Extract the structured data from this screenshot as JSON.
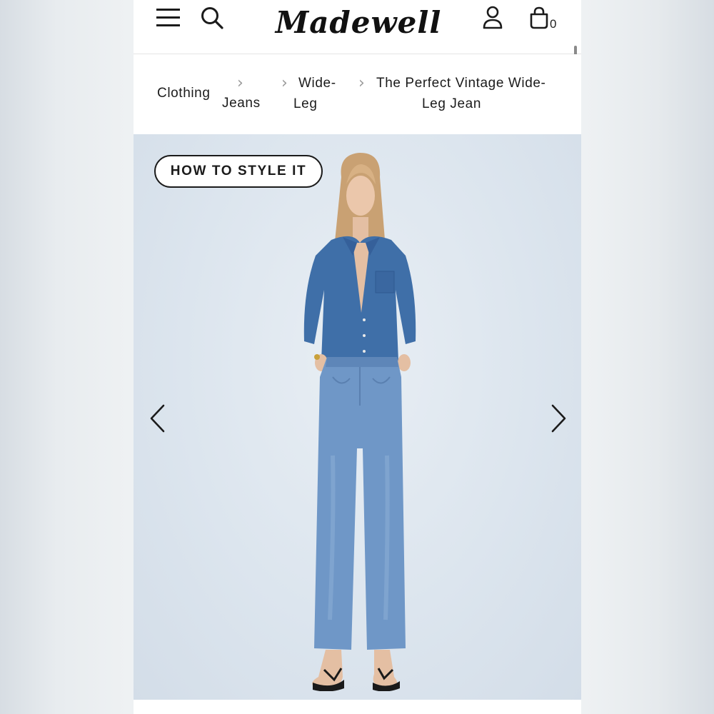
{
  "header": {
    "brand": "Madewell",
    "bag_count": "0",
    "icons": {
      "menu": "hamburger-menu-icon",
      "search": "search-icon",
      "account": "person-icon",
      "bag": "shopping-bag-icon"
    }
  },
  "breadcrumb": {
    "items": [
      {
        "label": "Clothing"
      },
      {
        "label": "Jeans"
      },
      {
        "label_line1": "Wide-",
        "label_line2": "Leg"
      },
      {
        "label_line1": "The Perfect Vintage Wide-",
        "label_line2": "Leg Jean"
      }
    ]
  },
  "hero": {
    "style_button_label": "HOW TO STYLE IT",
    "icons": {
      "prev": "chevron-left-icon",
      "next": "chevron-right-icon"
    }
  },
  "colors": {
    "text": "#1b1b1b",
    "hero_background": "#dce5ee",
    "denim": "#6f97c7",
    "shirt": "#3f6fa8"
  }
}
